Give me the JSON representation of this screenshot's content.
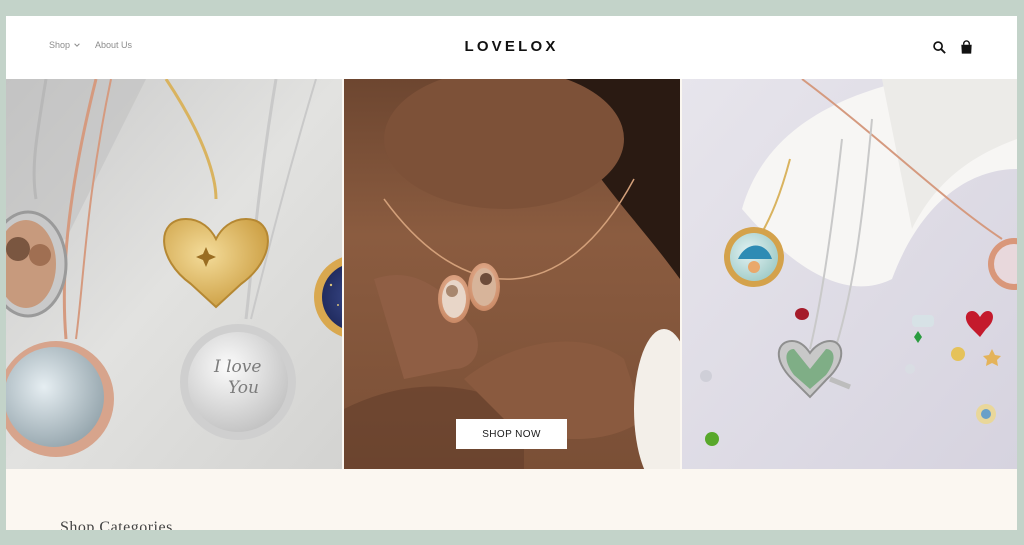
{
  "header": {
    "logo": "LOVELOX",
    "nav": [
      {
        "label": "Shop"
      },
      {
        "label": "About Us"
      }
    ],
    "icons": [
      "search-icon",
      "bag-icon"
    ]
  },
  "hero": {
    "cta_label": "SHOP NOW",
    "engraving_line1": "I love",
    "engraving_line2": "You"
  },
  "section": {
    "title": "Shop Categories"
  },
  "colors": {
    "page_background": "#c3d3c9",
    "section_background": "#fbf7f1",
    "logo": "#111111"
  }
}
